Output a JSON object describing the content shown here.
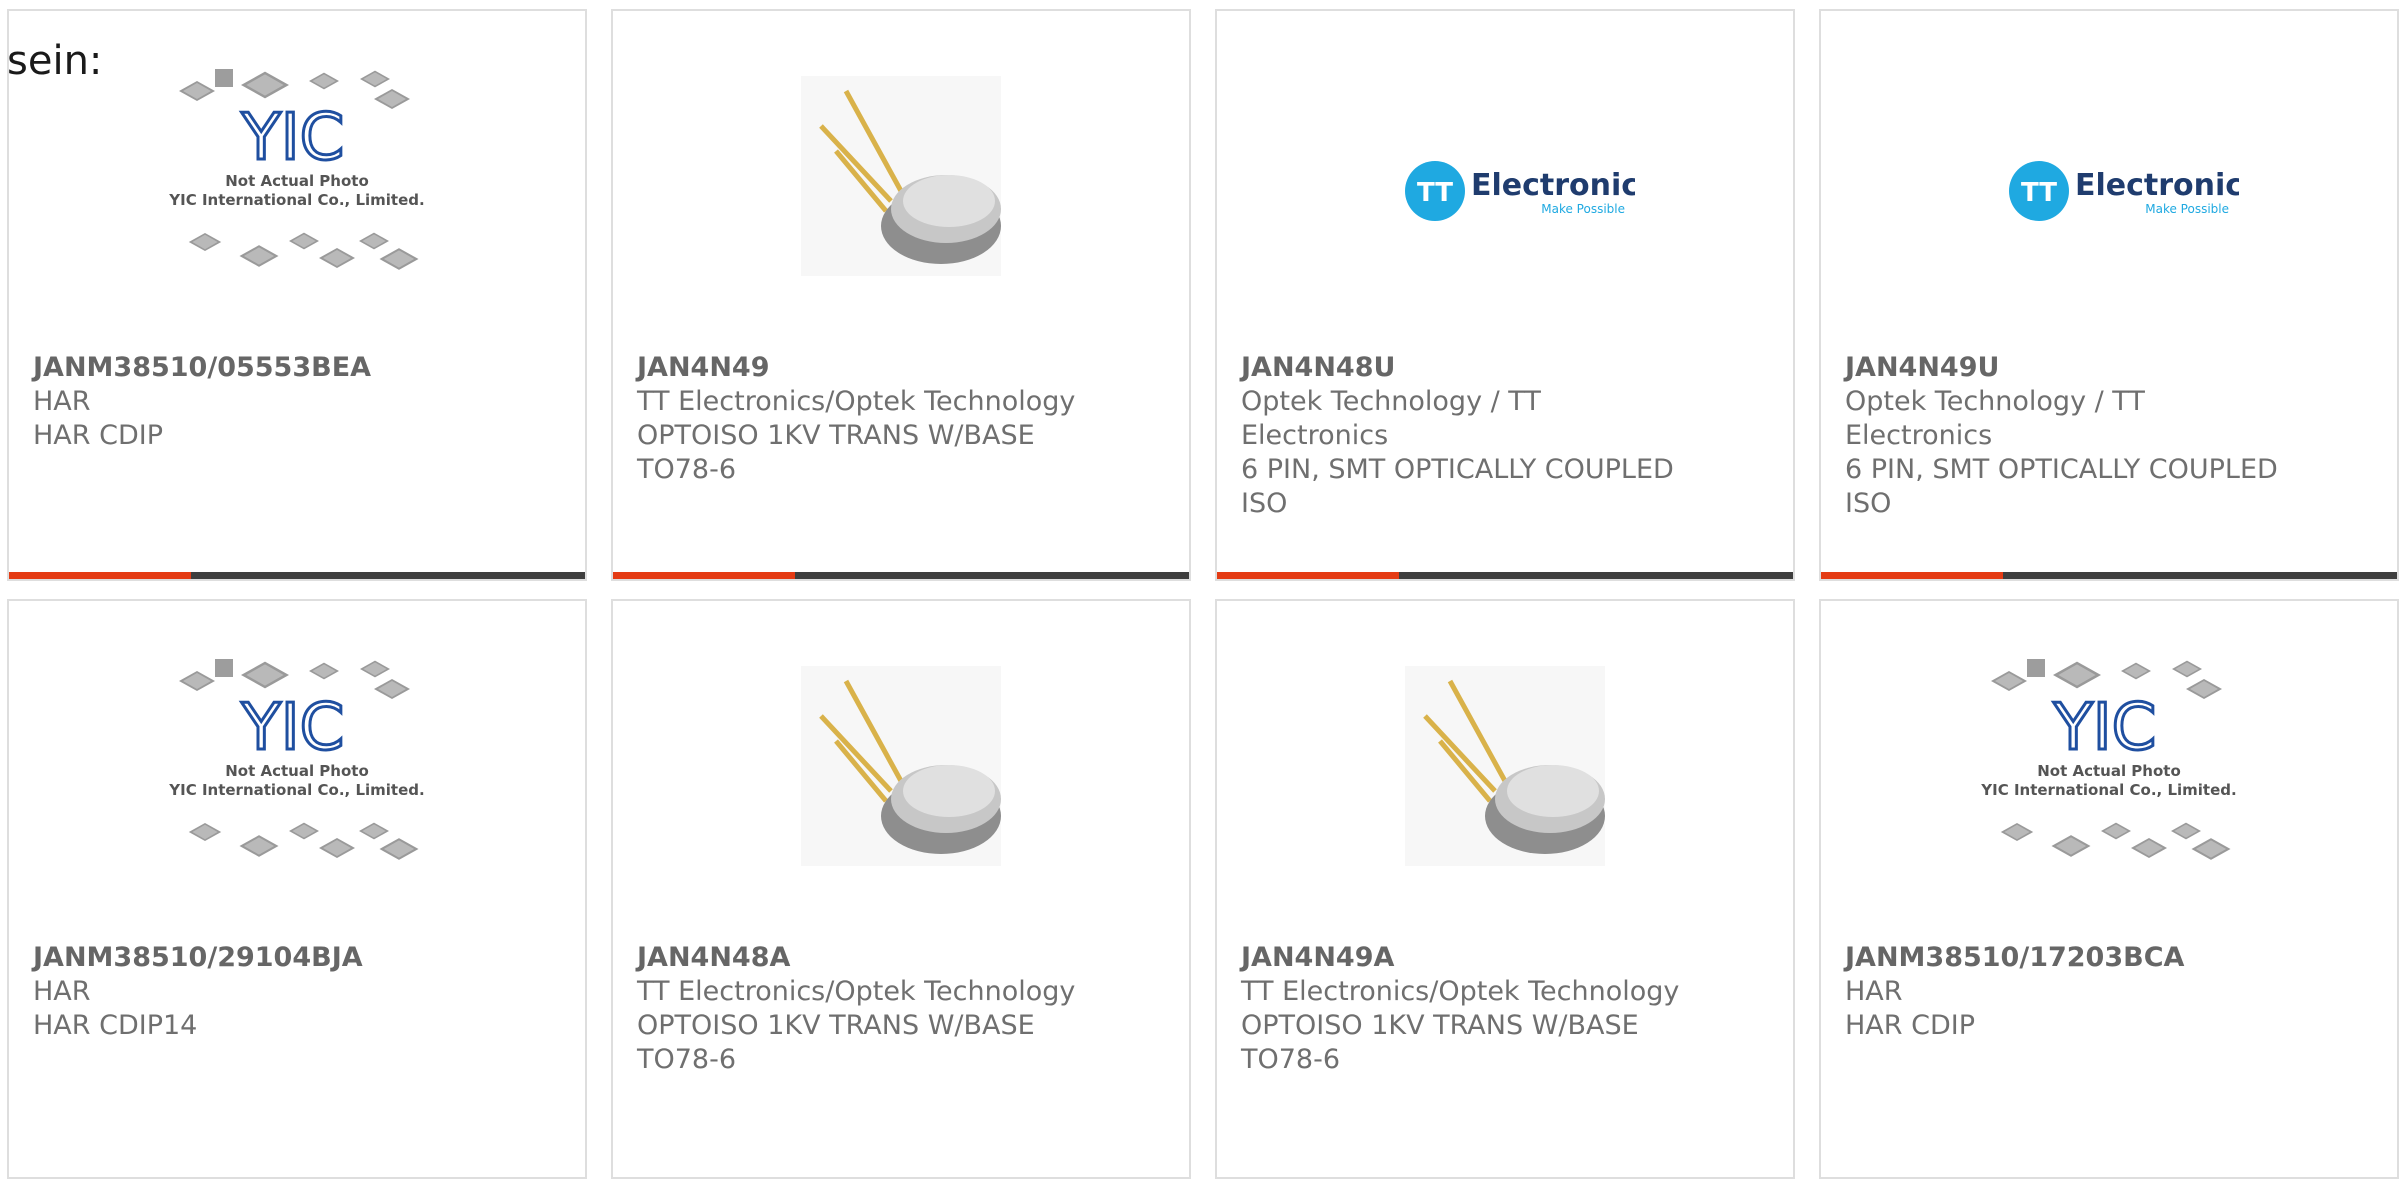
{
  "heading": "sein:",
  "colors": {
    "accent": "#e43b14",
    "bar": "#3e3e3e",
    "tt_blue": "#1fa9e1",
    "yic_blue": "#1f4fa0"
  },
  "placeholder_text": {
    "line1": "Not Actual Photo",
    "line2": "YIC International Co., Limited."
  },
  "brand_logo": {
    "name": "Electronics",
    "tagline": "Make Possible",
    "mark": "TT"
  },
  "cards": [
    {
      "image": "placeholder-photo",
      "part": "JANM38510/05553BEA",
      "lines": [
        "HAR",
        "HAR CDIP"
      ]
    },
    {
      "image": "to78-component-photo",
      "part": "JAN4N49",
      "lines": [
        "TT Electronics/Optek Technology",
        "OPTOISO 1KV TRANS W/BASE",
        "TO78-6"
      ]
    },
    {
      "image": "tt-electronics-logo",
      "part": "JAN4N48U",
      "lines": [
        "Optek Technology / TT",
        "Electronics",
        "6 PIN, SMT OPTICALLY COUPLED",
        "ISO"
      ]
    },
    {
      "image": "tt-electronics-logo",
      "part": "JAN4N49U",
      "lines": [
        "Optek Technology / TT",
        "Electronics",
        "6 PIN, SMT OPTICALLY COUPLED",
        "ISO"
      ]
    },
    {
      "image": "placeholder-photo",
      "part": "JANM38510/29104BJA",
      "lines": [
        "HAR",
        "HAR CDIP14"
      ]
    },
    {
      "image": "to78-component-photo",
      "part": "JAN4N48A",
      "lines": [
        "TT Electronics/Optek Technology",
        "OPTOISO 1KV TRANS W/BASE",
        "TO78-6"
      ]
    },
    {
      "image": "to78-component-photo",
      "part": "JAN4N49A",
      "lines": [
        "TT Electronics/Optek Technology",
        "OPTOISO 1KV TRANS W/BASE",
        "TO78-6"
      ]
    },
    {
      "image": "placeholder-photo",
      "part": "JANM38510/17203BCA",
      "lines": [
        "HAR",
        "HAR CDIP"
      ]
    }
  ]
}
